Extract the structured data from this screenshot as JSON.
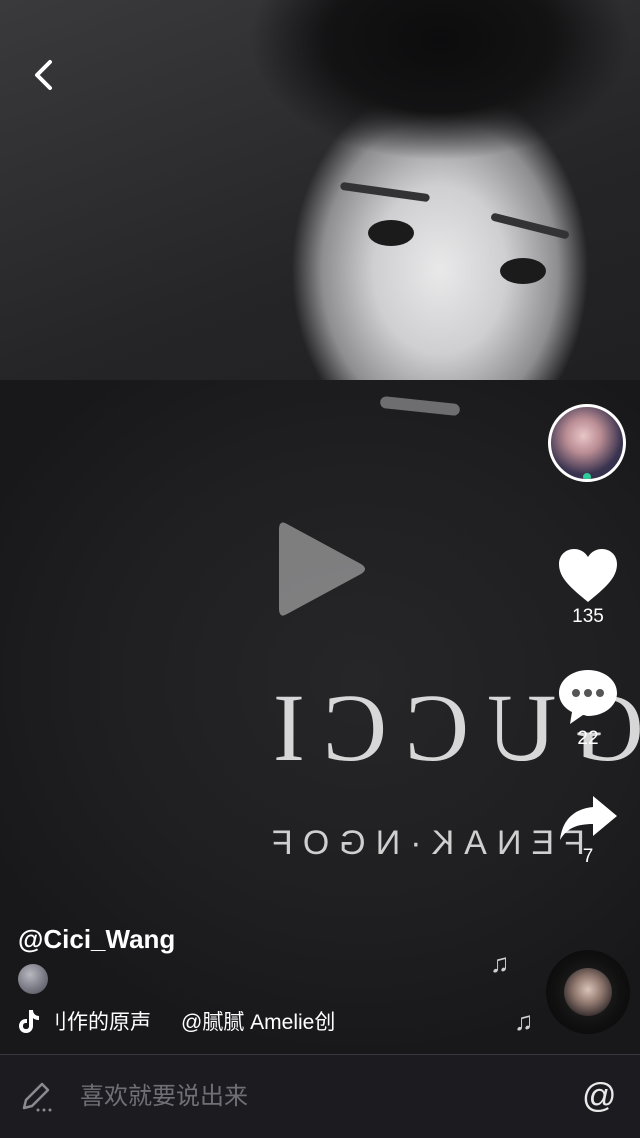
{
  "video": {
    "shirt_text": "GUCCI",
    "shirt_subtext": "FENAK·NGOF"
  },
  "actions": {
    "likes": "135",
    "comments": "22",
    "shares": "7"
  },
  "author": {
    "username": "@Cici_Wang"
  },
  "music": {
    "label": "刂作的原声",
    "artist": "@腻腻 Amelie创"
  },
  "comment_bar": {
    "placeholder": "喜欢就要说出来",
    "at_symbol": "@"
  },
  "icons": {
    "back": "chevron-left-icon",
    "play": "play-icon",
    "like": "heart-icon",
    "comment": "comment-bubble-icon",
    "share": "share-arrow-icon",
    "music": "tiktok-note-icon",
    "edit": "pencil-icon"
  }
}
